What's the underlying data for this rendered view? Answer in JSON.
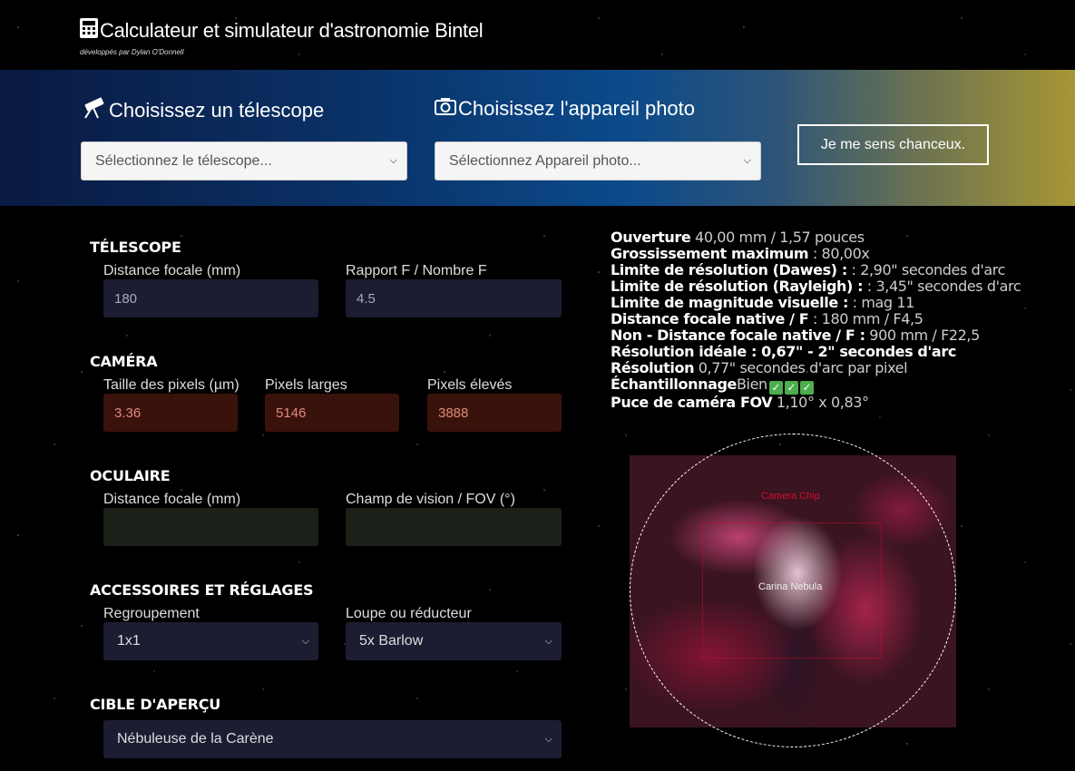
{
  "header": {
    "title": "Calculateur et simulateur d'astronomie Bintel",
    "subtitle": "développés par Dylan O'Donnell",
    "icon": "calculator-icon"
  },
  "selectors": {
    "telescope_heading": "Choisissez un télescope",
    "telescope_placeholder": "Sélectionnez le télescope...",
    "camera_heading": "Choisissez l'appareil photo",
    "camera_placeholder": "Sélectionnez Appareil photo...",
    "lucky_button": "Je me sens chanceux."
  },
  "telescope": {
    "heading": "TÉLESCOPE",
    "focal_label": "Distance focale (mm)",
    "focal_value": "180",
    "ratio_label": "Rapport F / Nombre F",
    "ratio_value": "4.5"
  },
  "camera": {
    "heading": "CAMÉRA",
    "pixel_size_label": "Taille des pixels (µm)",
    "pixel_size_value": "3.36",
    "width_label": "Pixels larges",
    "width_value": "5146",
    "height_label": "Pixels élevés",
    "height_value": "3888"
  },
  "eyepiece": {
    "heading": "OCULAIRE",
    "focal_label": "Distance focale (mm)",
    "focal_value": "",
    "fov_label": "Champ de vision / FOV (°)",
    "fov_value": ""
  },
  "accessories": {
    "heading": "ACCESSOIRES ET RÉGLAGES",
    "binning_label": "Regroupement",
    "binning_value": "1x1",
    "barlow_label": "Loupe ou réducteur",
    "barlow_value": "5x Barlow"
  },
  "target": {
    "heading": "CIBLE D'APERÇU",
    "value": "Nébuleuse de la Carène"
  },
  "stats": [
    {
      "label": "Ouverture",
      "value": " 40,00 mm / 1,57 pouces"
    },
    {
      "label": "Grossissement maximum",
      "value": " : 80,00x"
    },
    {
      "label": "Limite de résolution (Dawes) :",
      "value": " : 2,90\" secondes d'arc"
    },
    {
      "label": "Limite de résolution (Rayleigh) :",
      "value": " : 3,45\" secondes d'arc"
    },
    {
      "label": "Limite de magnitude visuelle :",
      "value": " : mag 11"
    },
    {
      "label": "Distance focale native / F",
      "value": " : 180 mm / F4,5"
    },
    {
      "label": "Non - Distance focale native / F :",
      "value": " 900 mm / F22,5"
    },
    {
      "label": "Résolution idéale : 0,67\" - 2\" secondes d'arc",
      "value": ""
    },
    {
      "label": "Résolution",
      "value": " 0,77\" secondes d'arc par pixel"
    },
    {
      "label": "Échantillonnage",
      "value": "Bien"
    },
    {
      "label": "Puce de caméra FOV",
      "value": " 1,10° x 0,83°"
    }
  ],
  "preview": {
    "chip_label": "Camera Chip",
    "target_label": "Carina Nebula"
  },
  "colors": {
    "chip_outline": "#c0102a",
    "check_green": "#4cae4c"
  }
}
